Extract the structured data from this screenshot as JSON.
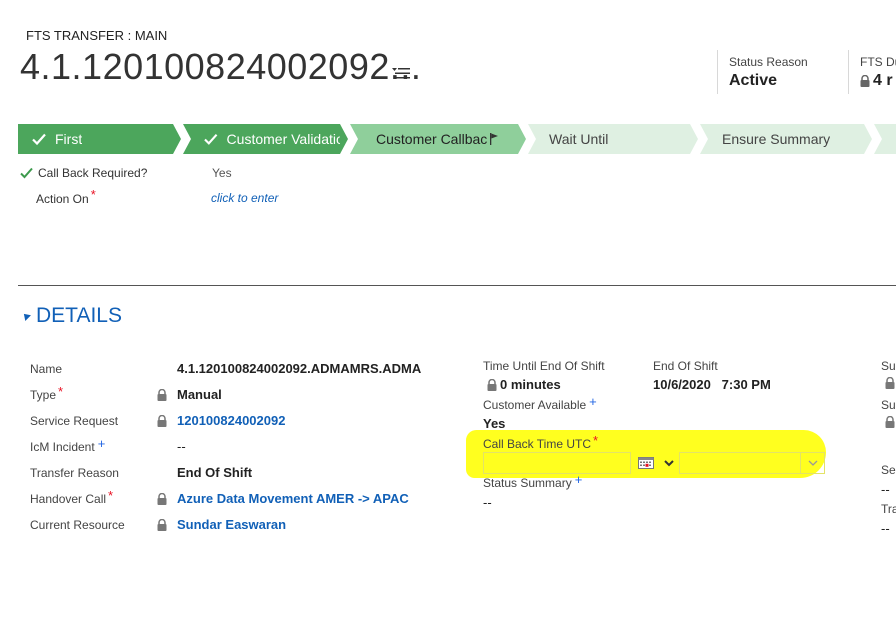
{
  "header": {
    "entity": "FTS TRANSFER : MAIN",
    "title": "4.1.120100824002092...",
    "fields": [
      {
        "label": "Status Reason",
        "value": "Active"
      },
      {
        "label": "FTS Du",
        "value": "4 r"
      }
    ]
  },
  "process": {
    "stages": [
      {
        "label": "First",
        "state": "done"
      },
      {
        "label": "Customer Validatio",
        "state": "done"
      },
      {
        "label": "Customer Callbac",
        "state": "active"
      },
      {
        "label": "Wait Until",
        "state": "pending"
      },
      {
        "label": "Ensure Summary",
        "state": "pending"
      }
    ],
    "steps": [
      {
        "label": "Call Back Required?",
        "value": "Yes",
        "checked": true
      },
      {
        "label": "Action On",
        "value": "click to enter",
        "required": "*"
      }
    ]
  },
  "details": {
    "title": "DETAILS",
    "left": [
      {
        "label": "Name",
        "value": "4.1.120100824002092.ADMAMRS.ADMA"
      },
      {
        "label": "Type",
        "value": "Manual",
        "required": "*"
      },
      {
        "label": "Service Request",
        "value": "120100824002092"
      },
      {
        "label": "IcM Incident",
        "value": "--",
        "recommended": "+"
      },
      {
        "label": "Transfer Reason",
        "value": "End Of Shift"
      },
      {
        "label": "Handover Call",
        "value": "Azure Data Movement AMER -> APAC",
        "required": "*"
      },
      {
        "label": "Current Resource",
        "value": "Sundar Easwaran"
      }
    ],
    "middle": {
      "time_until_label": "Time Until End Of Shift",
      "time_until_value": "0 minutes",
      "end_of_shift_label": "End Of Shift",
      "end_of_shift_value": "10/6/2020   7:30 PM",
      "customer_available_label": "Customer Available",
      "customer_available_mark": "+",
      "customer_available_value": "Yes",
      "call_back_label": "Call Back Time UTC",
      "call_back_mark": "*",
      "call_back_date": "",
      "call_back_time": "",
      "status_summary_label": "Status Summary",
      "status_summary_mark": "+",
      "status_summary_value": "--"
    },
    "right": {
      "l1": "Su",
      "l2": "Su",
      "l3": "Sel",
      "v3": "--",
      "l4": "Tra",
      "v4": "--"
    }
  },
  "colors": {
    "stage_done": "#4ca65c",
    "stage_active": "#8fcf9b",
    "stage_pending": "#dff0e2",
    "link": "#1160b7",
    "highlight": "#ffff1f",
    "required": "#e81123"
  }
}
